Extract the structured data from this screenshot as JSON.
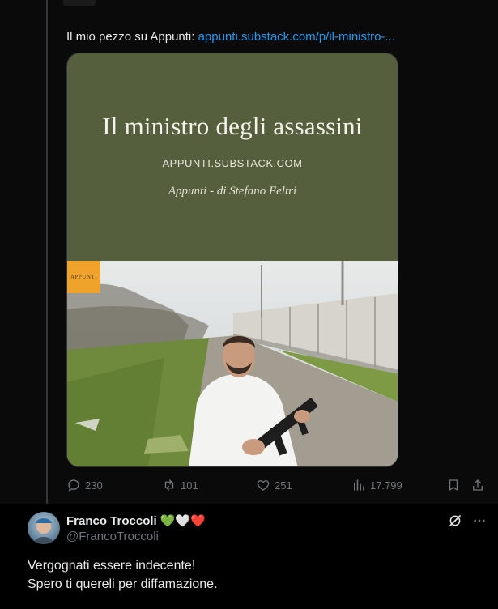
{
  "post": {
    "text_prefix": "Il mio pezzo su Appunti: ",
    "link_text": "appunti.substack.com/p/il-ministro-..."
  },
  "card": {
    "title": "Il ministro degli assassini",
    "domain": "APPUNTI.SUBSTACK.COM",
    "subtitle": "Appunti - di Stefano Feltri",
    "badge_text": "APPUNTI",
    "bg_color": "#565f3d"
  },
  "actions": {
    "replies": "230",
    "reposts": "101",
    "likes": "251",
    "views": "17.799"
  },
  "reply": {
    "name": "Franco Troccoli",
    "hearts": "💚🤍❤️",
    "handle": "@FrancoTroccoli",
    "line1": "Vergognati essere indecente!",
    "line2": "Spero ti quereli per diffamazione."
  },
  "colors": {
    "link": "#1d9bf0",
    "muted": "#71767b"
  }
}
